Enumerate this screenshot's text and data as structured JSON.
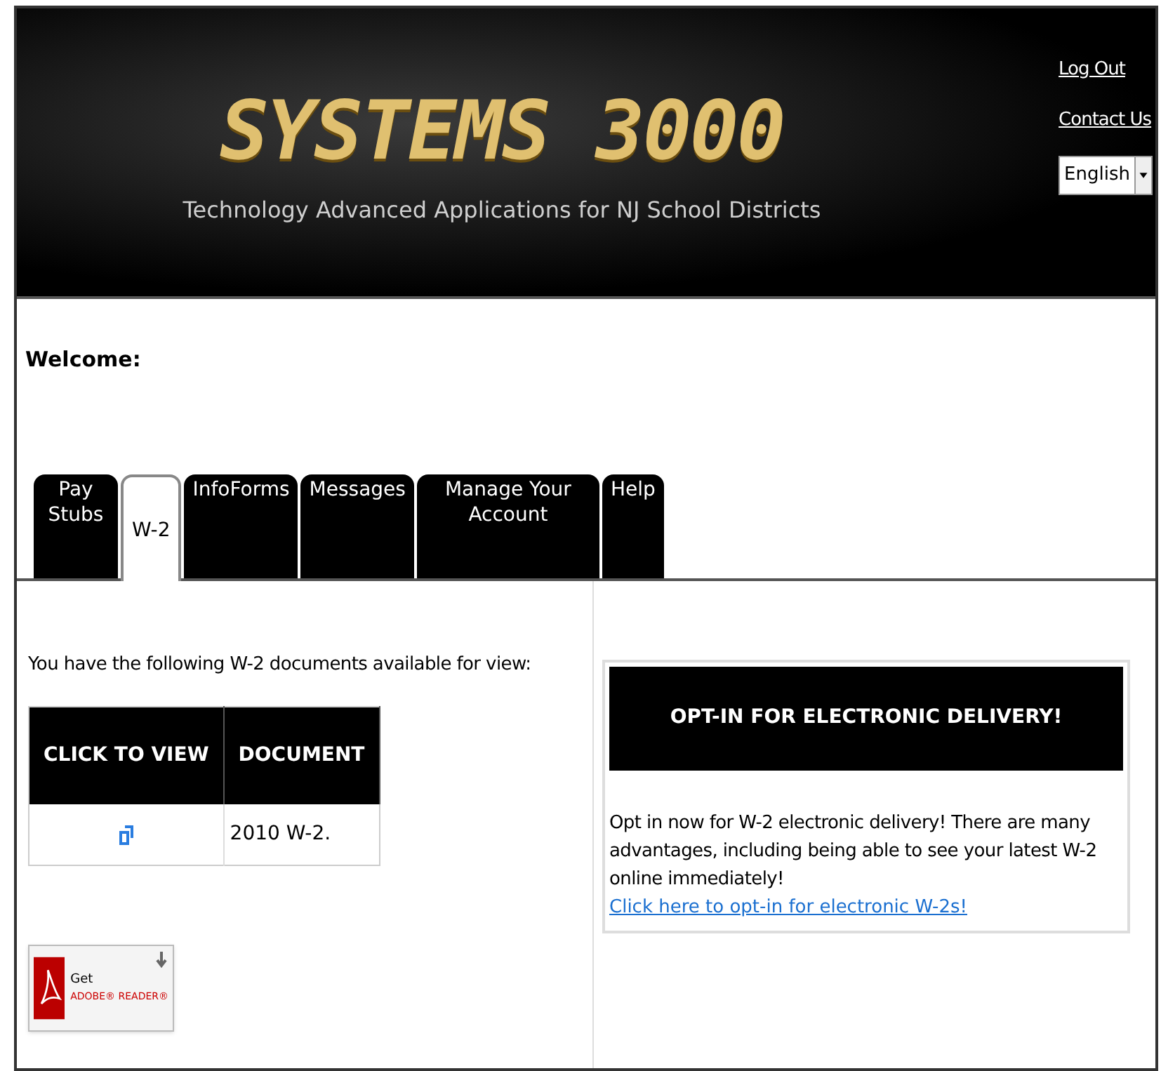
{
  "header": {
    "logo": "SYSTEMS 3000",
    "tagline": "Technology Advanced Applications for NJ School Districts",
    "links": [
      "Log Out",
      "Contact Us"
    ],
    "language": {
      "value": "English"
    }
  },
  "welcome": "Welcome:",
  "tabs": [
    {
      "label": "Pay Stubs",
      "selected": false
    },
    {
      "label": "W-2",
      "selected": true
    },
    {
      "label": "InfoForms",
      "selected": false
    },
    {
      "label": "Messages",
      "selected": false
    },
    {
      "label": "Manage Your Account",
      "selected": false
    },
    {
      "label": "Help",
      "selected": false
    }
  ],
  "documents": {
    "intro": "You have the following W-2 documents available for view:",
    "columns": [
      "CLICK TO VIEW",
      "DOCUMENT"
    ],
    "rows": [
      {
        "document": "2010 W-2."
      }
    ]
  },
  "adobe_badge": {
    "line_1": "Get",
    "line_2": "ADOBE® READER®"
  },
  "opt_in": {
    "title": "OPT-IN FOR ELECTRONIC DELIVERY!",
    "body": "Opt in now for W-2 electronic delivery! There are many advantages, including being able to see your latest W-2 online immediately!",
    "link": "Click here to opt-in for electronic W-2s!"
  }
}
